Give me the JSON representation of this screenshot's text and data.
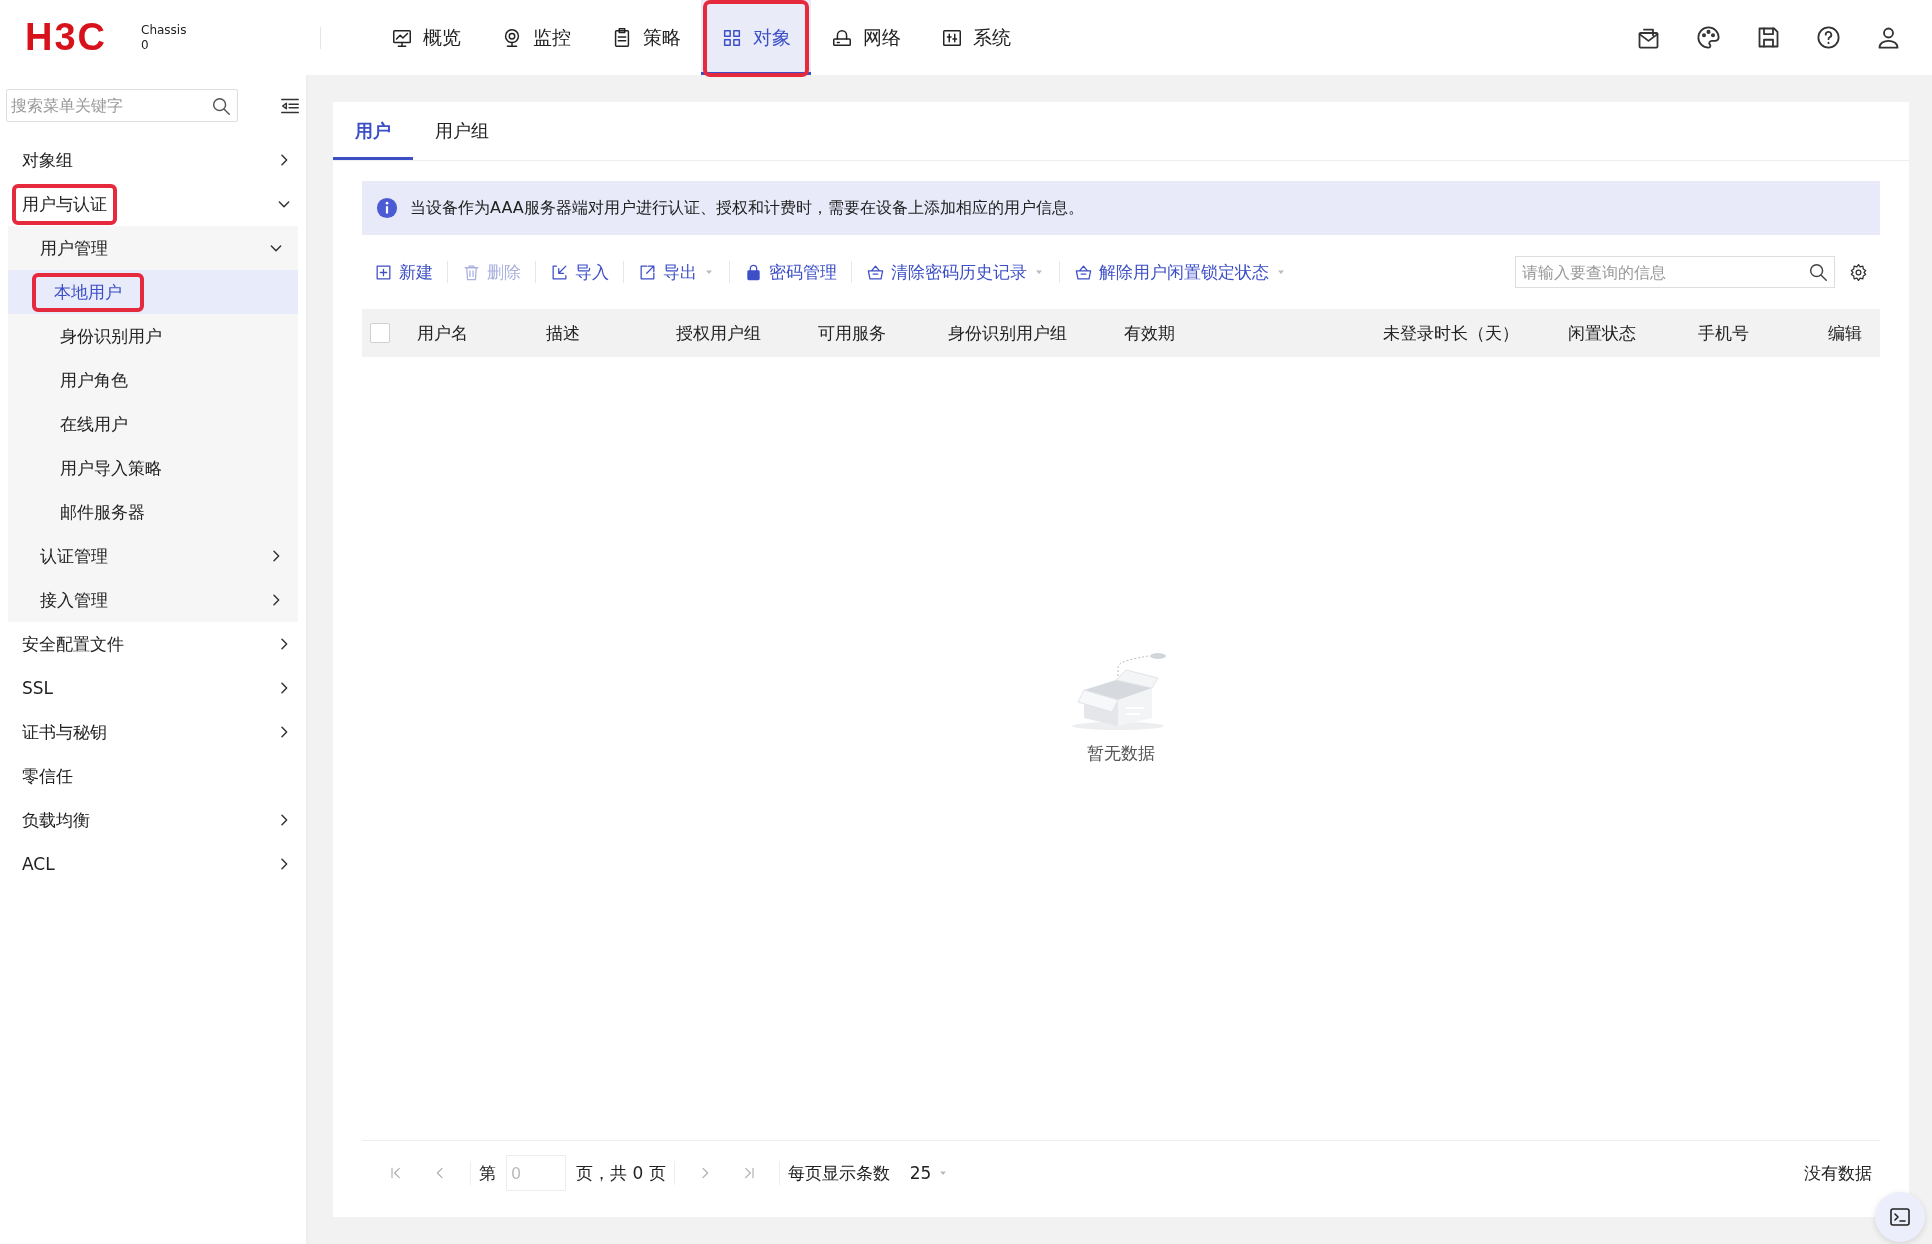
{
  "header": {
    "logo": "H3C",
    "device": {
      "name": "Chassis",
      "value": "0"
    },
    "nav": [
      {
        "label": "概览",
        "selected": false,
        "highlighted": false
      },
      {
        "label": "监控",
        "selected": false,
        "highlighted": false
      },
      {
        "label": "策略",
        "selected": false,
        "highlighted": false
      },
      {
        "label": "对象",
        "selected": true,
        "highlighted": true
      },
      {
        "label": "网络",
        "selected": false,
        "highlighted": false
      },
      {
        "label": "系统",
        "selected": false,
        "highlighted": false
      }
    ]
  },
  "sidebar": {
    "search": {
      "placeholder": "搜索菜单关键字"
    },
    "items": [
      {
        "label": "对象组",
        "expanded": false,
        "selected": false,
        "highlighted": false
      },
      {
        "label": "用户与认证",
        "expanded": true,
        "selected": false,
        "highlighted": true,
        "children": [
          {
            "label": "用户管理",
            "expanded": true,
            "selected": false,
            "highlighted": false,
            "children": [
              {
                "label": "本地用户",
                "selected": true,
                "highlighted": true
              },
              {
                "label": "身份识别用户",
                "selected": false,
                "highlighted": false
              },
              {
                "label": "用户角色",
                "selected": false,
                "highlighted": false
              },
              {
                "label": "在线用户",
                "selected": false,
                "highlighted": false
              },
              {
                "label": "用户导入策略",
                "selected": false,
                "highlighted": false
              },
              {
                "label": "邮件服务器",
                "selected": false,
                "highlighted": false
              }
            ]
          },
          {
            "label": "认证管理",
            "expanded": false,
            "selected": false,
            "highlighted": false
          },
          {
            "label": "接入管理",
            "expanded": false,
            "selected": false,
            "highlighted": false
          }
        ]
      },
      {
        "label": "安全配置文件",
        "expanded": false,
        "selected": false,
        "highlighted": false
      },
      {
        "label": "SSL",
        "expanded": false,
        "selected": false,
        "highlighted": false
      },
      {
        "label": "证书与秘钥",
        "expanded": false,
        "selected": false,
        "highlighted": false
      },
      {
        "label": "零信任",
        "selected": false,
        "highlighted": false
      },
      {
        "label": "负载均衡",
        "expanded": false,
        "selected": false,
        "highlighted": false
      },
      {
        "label": "ACL",
        "expanded": false,
        "selected": false,
        "highlighted": false
      }
    ]
  },
  "tabs": [
    {
      "label": "用户",
      "selected": true
    },
    {
      "label": "用户组",
      "selected": false
    }
  ],
  "info": "当设备作为AAA服务器端对用户进行认证、授权和计费时，需要在设备上添加相应的用户信息。",
  "toolbar": [
    {
      "label": "新建",
      "disabled": false,
      "dropdown": false
    },
    {
      "label": "删除",
      "disabled": true,
      "dropdown": false
    },
    {
      "label": "导入",
      "disabled": false,
      "dropdown": false
    },
    {
      "label": "导出",
      "disabled": false,
      "dropdown": true
    },
    {
      "label": "密码管理",
      "disabled": false,
      "dropdown": false
    },
    {
      "label": "清除密码历史记录",
      "disabled": false,
      "dropdown": true
    },
    {
      "label": "解除用户闲置锁定状态",
      "disabled": false,
      "dropdown": true
    }
  ],
  "table_search": {
    "placeholder": "请输入要查询的信息"
  },
  "table": {
    "select_all": {
      "checked": false
    },
    "columns": [
      "用户名",
      "描述",
      "授权用户组",
      "可用服务",
      "身份识别用户组",
      "有效期",
      "未登录时长（天）",
      "闲置状态",
      "手机号",
      "编辑"
    ],
    "empty_text": "暂无数据"
  },
  "pagination": {
    "page_prefix": "第",
    "page_input": {
      "placeholder": "0"
    },
    "page_suffix": "页，共 0 页",
    "page_size_label": "每页显示条数",
    "page_size": "25",
    "summary": "没有数据"
  }
}
